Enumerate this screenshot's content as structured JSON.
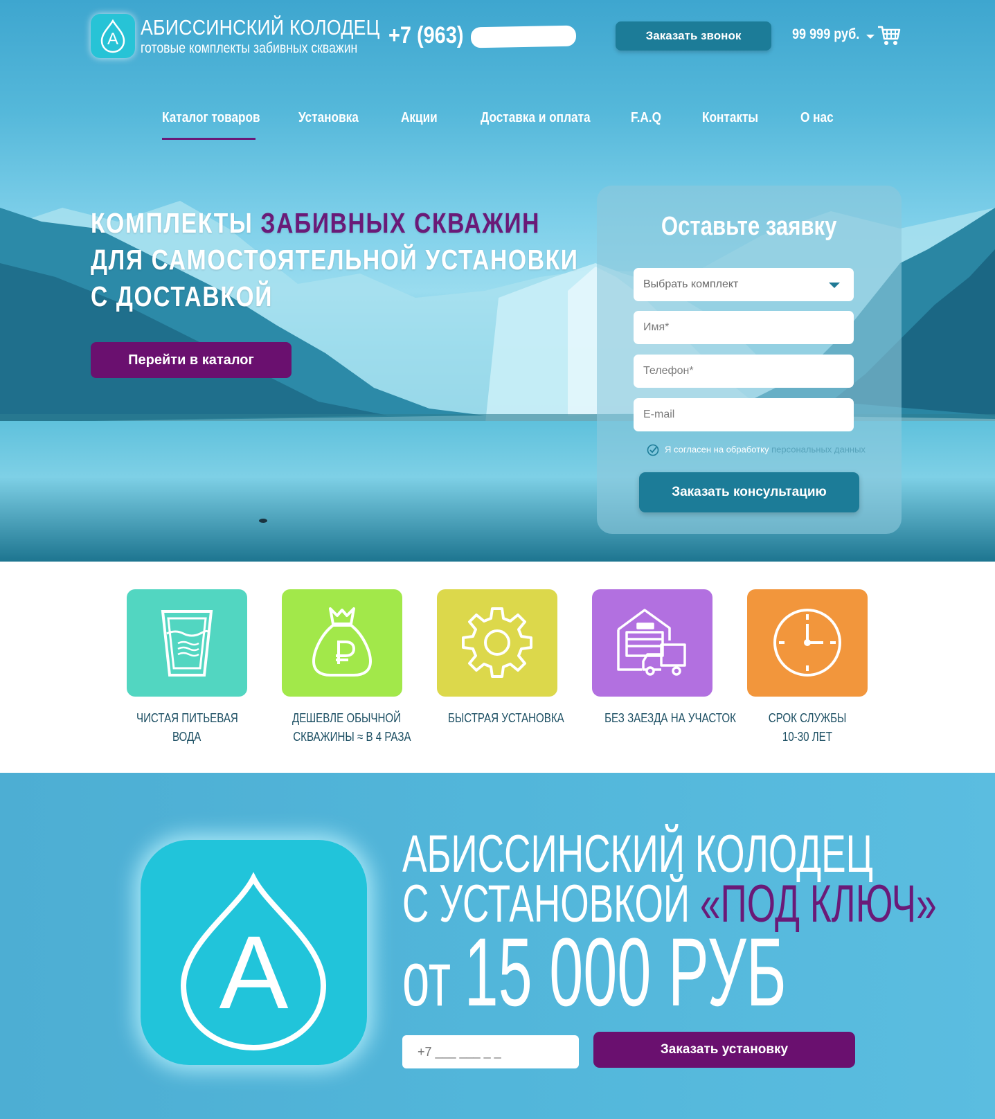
{
  "header": {
    "brand_title": "АБИССИНСКИЙ КОЛОДЕЦ",
    "brand_subtitle": "готовые комплекты забивных скважин",
    "logo_letter": "A",
    "phone": "+7 (963)",
    "call_button": "Заказать звонок",
    "cart_sum": "99 999 руб.",
    "cart_icon": "shopping-cart-icon"
  },
  "nav": {
    "items": [
      "Каталог товаров",
      "Установка",
      "Акции",
      "Доставка и оплата",
      "F.A.Q",
      "Контакты",
      "О нас"
    ],
    "active": "Каталог товаров"
  },
  "hero": {
    "title_part1": "КОМПЛЕКТЫ ",
    "title_accent": "ЗАБИВНЫХ СКВАЖИН",
    "title_line2": "ДЛЯ САМОСТОЯТЕЛЬНОЙ УСТАНОВКИ",
    "title_line3": "С ДОСТАВКОЙ",
    "catalog_button": "Перейти в каталог"
  },
  "form": {
    "title": "Оставьте заявку",
    "select_placeholder": "Выбрать комплект",
    "name_placeholder": "Имя*",
    "phone_placeholder": "Телефон*",
    "email_placeholder": "E-mail",
    "consent_text": "Я согласен на обработку ",
    "consent_link": "персональных данных",
    "submit": "Заказать консультацию"
  },
  "features": [
    {
      "line1": "ЧИСТАЯ ПИТЬЕВАЯ",
      "line2": "ВОДА",
      "color": "#52d6c1",
      "icon": "water-glass-icon"
    },
    {
      "line1": "ДЕШЕВЛЕ ОБЫЧНОЙ",
      "line2": "СКВАЖИНЫ ≈ В 4 РАЗА",
      "color": "#a2e84a",
      "icon": "money-bag-icon"
    },
    {
      "line1": "БЫСТРАЯ УСТАНОВКА",
      "line2": "",
      "color": "#dcd84b",
      "icon": "gear-icon"
    },
    {
      "line1": "БЕЗ ЗАЕЗДА НА УЧАСТОК",
      "line2": "",
      "color": "#b270e0",
      "icon": "warehouse-truck-icon"
    },
    {
      "line1": "СРОК СЛУЖБЫ",
      "line2": "10-30 ЛЕТ",
      "color": "#f2963c",
      "icon": "clock-icon"
    }
  ],
  "promo": {
    "line1": "АБИССИНСКИЙ КОЛОДЕЦ",
    "line2_prefix": "С УСТАНОВКОЙ ",
    "line2_accent": "«ПОД КЛЮЧ»",
    "line3_prefix": "от ",
    "line3_price": "15 000 РУБ",
    "phone_placeholder": "+7 ___ ___ _ _",
    "button": "Заказать установку",
    "logo_letter": "A"
  },
  "colors": {
    "accent_purple": "#6a106f",
    "primary_teal": "#1c7c98",
    "text_dark": "#1c4f63"
  }
}
